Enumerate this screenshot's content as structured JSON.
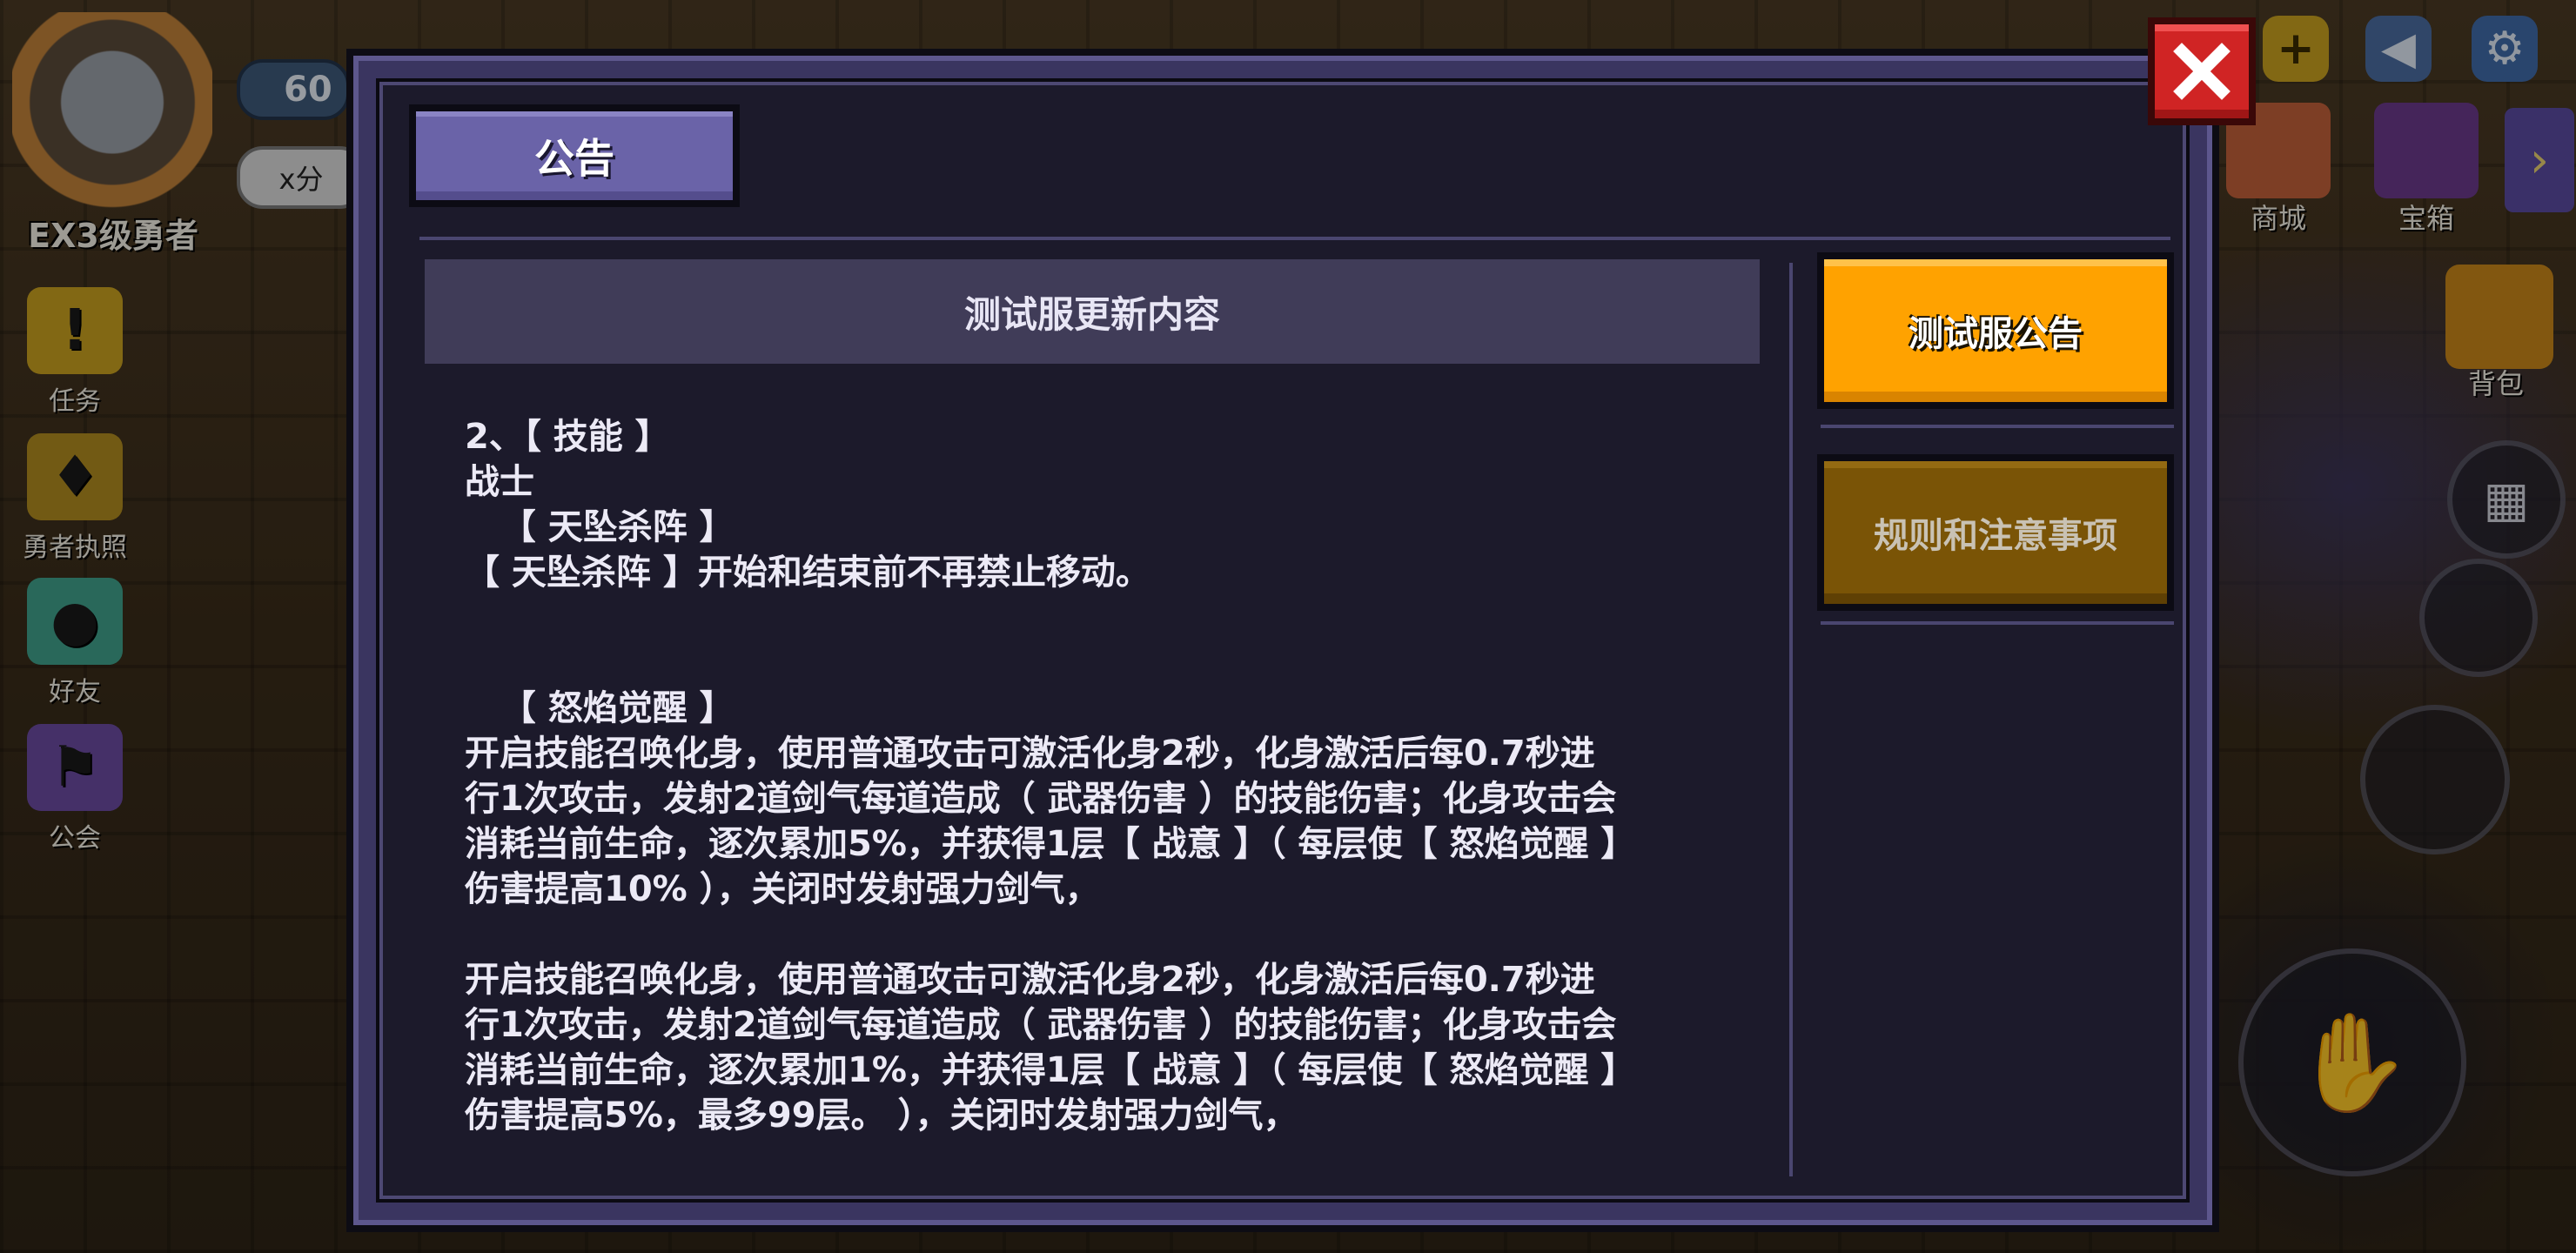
{
  "hud": {
    "level": "60",
    "tag": "x分",
    "player_rank": "EX3级勇者",
    "side_buttons": [
      {
        "label": "任务",
        "icon": "exclamation-icon"
      },
      {
        "label": "勇者执照",
        "icon": "license-icon"
      },
      {
        "label": "好友",
        "icon": "friend-icon"
      },
      {
        "label": "公会",
        "icon": "guild-icon"
      }
    ],
    "right_menu": {
      "shop": "商城",
      "chest": "宝箱",
      "bag": "背包"
    }
  },
  "dialog": {
    "title": "公告",
    "content_header": "测试服更新内容",
    "tabs": [
      {
        "label": "测试服公告",
        "active": true
      },
      {
        "label": "规则和注意事项",
        "active": false
      }
    ],
    "body_lines": [
      "2、【 技能 】",
      "战士",
      "   【 天坠杀阵 】",
      "【 天坠杀阵 】开始和结束前不再禁止移动。",
      "",
      "",
      "   【 怒焰觉醒 】",
      "开启技能召唤化身，使用普通攻击可激活化身2秒，化身激活后每0.7秒进",
      "行1次攻击，发射2道剑气每道造成（ 武器伤害 ）的技能伤害；化身攻击会",
      "消耗当前生命，逐次累加5%，并获得1层【 战意 】（ 每层使【 怒焰觉醒 】",
      "伤害提高10% ），关闭时发射强力剑气，",
      "",
      "开启技能召唤化身，使用普通攻击可激活化身2秒，化身激活后每0.7秒进",
      "行1次攻击，发射2道剑气每道造成（ 武器伤害 ）的技能伤害；化身攻击会",
      "消耗当前生命，逐次累加1%，并获得1层【 战意 】（ 每层使【 怒焰觉醒 】",
      "伤害提高5%，最多99层。 ），关闭时发射强力剑气，"
    ]
  },
  "colors": {
    "dialog_frame": "#3a3560",
    "dialog_bg": "#1c1a2b",
    "title_tab": "#6a63a8",
    "active_tab": "#ffa200",
    "inactive_tab": "#7a5406",
    "close_button": "#d02424"
  }
}
